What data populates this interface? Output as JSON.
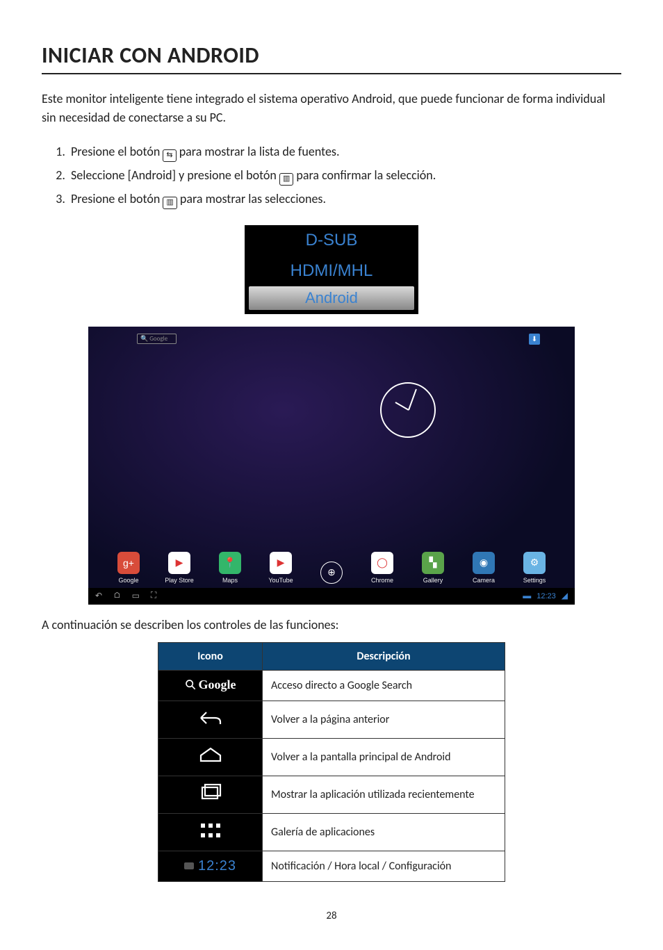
{
  "title": "INICIAR CON ANDROID",
  "intro": "Este monitor inteligente tiene integrado el sistema operativo Android, que puede funcionar de forma individual sin necesidad de conectarse a su PC.",
  "steps": {
    "s1a": "Presione el botón ",
    "s1b": " para mostrar la lista de fuentes.",
    "s2a": "Seleccione [Android] y presione el botón ",
    "s2b": " para confirmar la selección.",
    "s3a": "Presione el botón ",
    "s3b": " para mostrar las selecciones."
  },
  "inline_icons": {
    "source": "⇆",
    "menu": "▥"
  },
  "source_menu": {
    "items": [
      "D-SUB",
      "HDMI/MHL",
      "Android"
    ],
    "selected": 2
  },
  "android": {
    "search_placeholder": "Google",
    "mic": "⬇",
    "dock": [
      {
        "name": "google-plus-icon",
        "label": "Google",
        "bg": "#d84c3a",
        "glyph": "g+"
      },
      {
        "name": "play-store-icon",
        "label": "Play Store",
        "bg": "#ffffff",
        "glyph": "▶"
      },
      {
        "name": "maps-icon",
        "label": "Maps",
        "bg": "#33b66a",
        "glyph": "📍"
      },
      {
        "name": "youtube-icon",
        "label": "YouTube",
        "bg": "#ffffff",
        "glyph": "▶"
      },
      {
        "name": "apps-icon",
        "label": "",
        "bg": "transparent",
        "glyph": "⊕"
      },
      {
        "name": "chrome-icon",
        "label": "Chrome",
        "bg": "#ffffff",
        "glyph": "◯"
      },
      {
        "name": "gallery-icon",
        "label": "Gallery",
        "bg": "#5aa34a",
        "glyph": "▚"
      },
      {
        "name": "camera-icon",
        "label": "Camera",
        "bg": "#3077b5",
        "glyph": "◉"
      },
      {
        "name": "settings-icon",
        "label": "Settings",
        "bg": "#6ab4e4",
        "glyph": "⚙"
      }
    ],
    "navbar_time": "12:23"
  },
  "caption": "A continuación se describen los controles de las funciones:",
  "table": {
    "headers": [
      "Icono",
      "Descripción"
    ],
    "rows": [
      {
        "icon": "google",
        "desc": "Acceso directo a Google Search"
      },
      {
        "icon": "back",
        "desc": "Volver a la página anterior"
      },
      {
        "icon": "home",
        "desc": "Volver a la pantalla principal de Android"
      },
      {
        "icon": "recent",
        "desc": "Mostrar la aplicación utilizada recientemente"
      },
      {
        "icon": "grid",
        "desc": "Galería de aplicaciones"
      },
      {
        "icon": "time",
        "time_value": "12:23",
        "desc": "Notificación / Hora local / Configuración"
      }
    ]
  },
  "page_number": "28"
}
